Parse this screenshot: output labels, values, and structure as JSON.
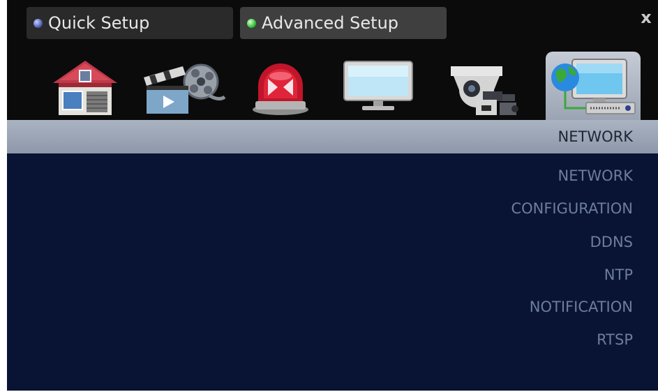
{
  "tabs": {
    "quick_setup": "Quick Setup",
    "advanced_setup": "Advanced Setup"
  },
  "close_label": "x",
  "toolbar": {
    "icons": [
      "home-icon",
      "video-clapper-icon",
      "alarm-siren-icon",
      "monitor-icon",
      "security-camera-icon",
      "network-icon"
    ],
    "active": "network-icon"
  },
  "section": {
    "title": "NETWORK"
  },
  "menu": {
    "items": [
      "NETWORK",
      "CONFIGURATION",
      "DDNS",
      "NTP",
      "NOTIFICATION",
      "RTSP"
    ]
  },
  "colors": {
    "background": "#0b0b0b",
    "content": "#091334",
    "menu_text": "#6e7d9c",
    "section_bar": "#a0a9b9",
    "quick_dot": "#5662b8",
    "advanced_dot": "#36c23a"
  }
}
